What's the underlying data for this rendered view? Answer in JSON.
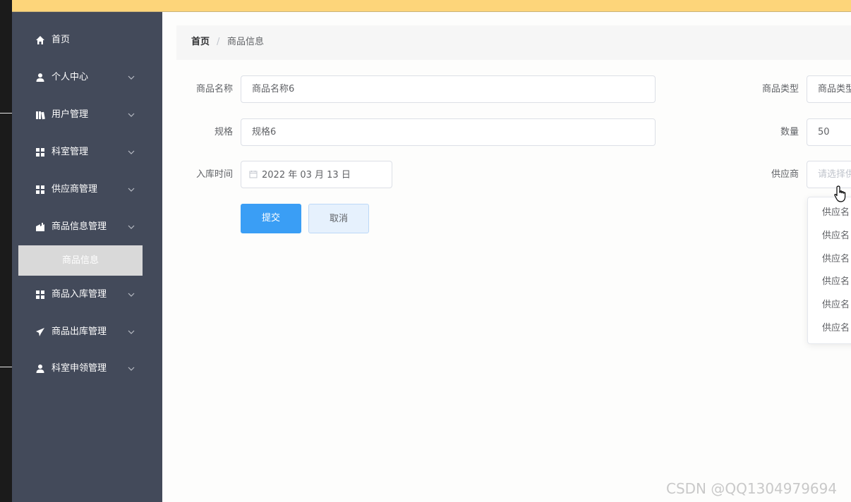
{
  "sidebar": {
    "items": [
      {
        "label": "首页",
        "icon": "home-icon",
        "has_children": false
      },
      {
        "label": "个人中心",
        "icon": "user-icon",
        "has_children": true
      },
      {
        "label": "用户管理",
        "icon": "users-icon",
        "has_children": true
      },
      {
        "label": "科室管理",
        "icon": "grid-icon",
        "has_children": true
      },
      {
        "label": "供应商管理",
        "icon": "grid-icon",
        "has_children": true
      },
      {
        "label": "商品信息管理",
        "icon": "goods-icon",
        "has_children": true
      },
      {
        "label": "商品入库管理",
        "icon": "grid-icon",
        "has_children": true
      },
      {
        "label": "商品出库管理",
        "icon": "send-icon",
        "has_children": true
      },
      {
        "label": "科室申领管理",
        "icon": "user-icon",
        "has_children": true
      }
    ],
    "active_sub_item": "商品信息"
  },
  "breadcrumb": {
    "home": "首页",
    "separator": "/",
    "current": "商品信息"
  },
  "form": {
    "name_label": "商品名称",
    "name_value": "商品名称6",
    "type_label": "商品类型",
    "type_value": "商品类型",
    "spec_label": "规格",
    "spec_value": "规格6",
    "qty_label": "数量",
    "qty_value": "50",
    "date_label": "入库时间",
    "date_value": "2022 年 03 月 13 日",
    "supplier_label": "供应商",
    "supplier_placeholder": "请选择供"
  },
  "buttons": {
    "submit": "提交",
    "cancel": "取消"
  },
  "supplier_dropdown": {
    "options": [
      "供应名",
      "供应名",
      "供应名",
      "供应名",
      "供应名",
      "供应名"
    ]
  },
  "watermark": "CSDN @QQ1304979694",
  "colors": {
    "topbar": "#fdd57a",
    "sidebar": "#434a5a",
    "primary": "#3a9ef5",
    "active_sub": "#d9d9d9"
  }
}
